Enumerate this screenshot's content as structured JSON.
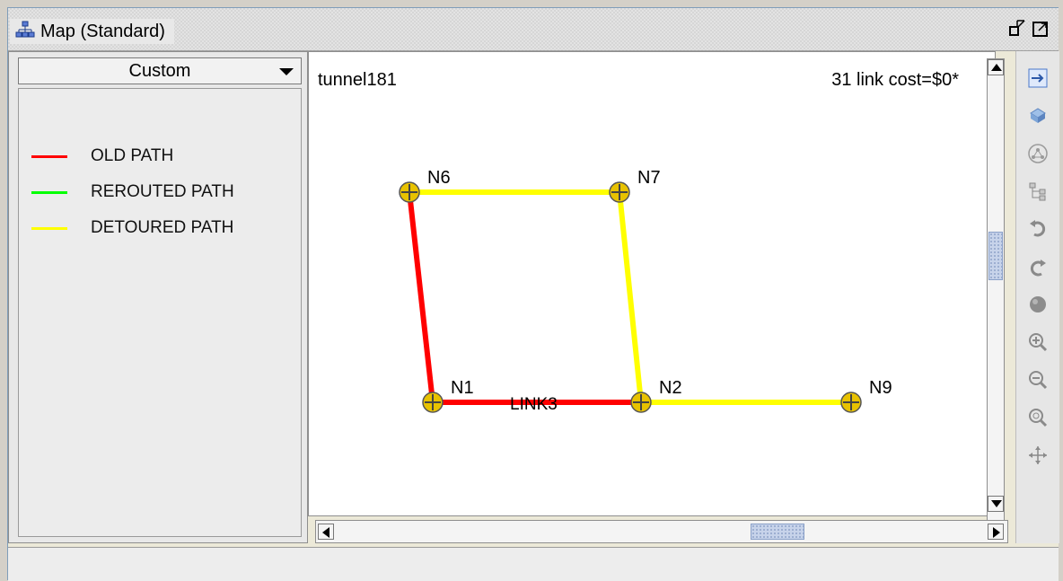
{
  "window": {
    "title": "Map (Standard)"
  },
  "left_panel": {
    "dropdown_value": "Custom",
    "legend": [
      {
        "label": "OLD PATH",
        "color": "#ff0000"
      },
      {
        "label": "REROUTED PATH",
        "color": "#00ff00"
      },
      {
        "label": "DETOURED PATH",
        "color": "#ffff00"
      }
    ]
  },
  "map": {
    "tunnel_label": "tunnel181",
    "link_cost_label": "31 link cost=$0*",
    "nodes": [
      {
        "id": "N6",
        "label": "N6"
      },
      {
        "id": "N7",
        "label": "N7"
      },
      {
        "id": "N1",
        "label": "N1"
      },
      {
        "id": "N2",
        "label": "N2"
      },
      {
        "id": "N9",
        "label": "N9"
      }
    ],
    "links": [
      {
        "from": "N6",
        "to": "N7",
        "path": "detoured"
      },
      {
        "from": "N6",
        "to": "N1",
        "path": "old"
      },
      {
        "from": "N7",
        "to": "N2",
        "path": "detoured"
      },
      {
        "from": "N1",
        "to": "N2",
        "path": "old",
        "label": "LINK3"
      },
      {
        "from": "N2",
        "to": "N9",
        "path": "detoured"
      }
    ],
    "colors": {
      "old": "#ff0000",
      "detoured": "#ffff00",
      "rerouted": "#00ff00",
      "node": "#e8c200"
    }
  },
  "toolbar": {
    "tools": [
      "fit-icon",
      "view-3d-icon",
      "layout-icon",
      "hierarchy-icon",
      "undo-icon",
      "redo-icon",
      "disc-icon",
      "zoom-in-icon",
      "zoom-out-icon",
      "zoom-fit-icon",
      "pan-icon"
    ]
  }
}
